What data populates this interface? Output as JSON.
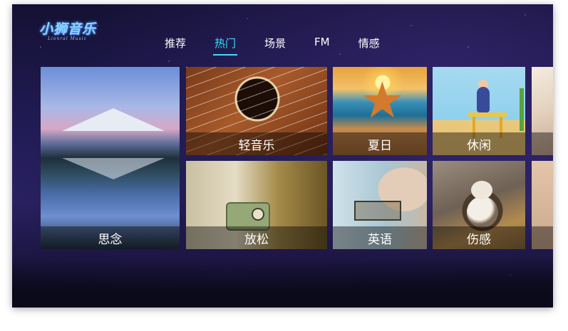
{
  "app": {
    "logo_text": "小狮音乐",
    "logo_subtitle": "Lionral Music"
  },
  "nav": {
    "tabs": [
      {
        "label": "推荐",
        "active": false
      },
      {
        "label": "热门",
        "active": true
      },
      {
        "label": "场景",
        "active": false
      },
      {
        "label": "FM",
        "active": false
      },
      {
        "label": "情感",
        "active": false
      }
    ]
  },
  "colors": {
    "accent": "#38e0ff",
    "background": "#211b55",
    "caption_overlay": "rgba(0,0,0,0.42)"
  },
  "tiles": [
    {
      "label": "思念",
      "image": "mountain-lake"
    },
    {
      "label": "轻音乐",
      "image": "ukulele"
    },
    {
      "label": "夏日",
      "image": "starfish-beach"
    },
    {
      "label": "休闲",
      "image": "girl-at-table"
    },
    {
      "label": "放松",
      "image": "vintage-radio"
    },
    {
      "label": "英语",
      "image": "woman-profile-boat"
    },
    {
      "label": "伤感",
      "image": "cat-on-chair"
    }
  ]
}
